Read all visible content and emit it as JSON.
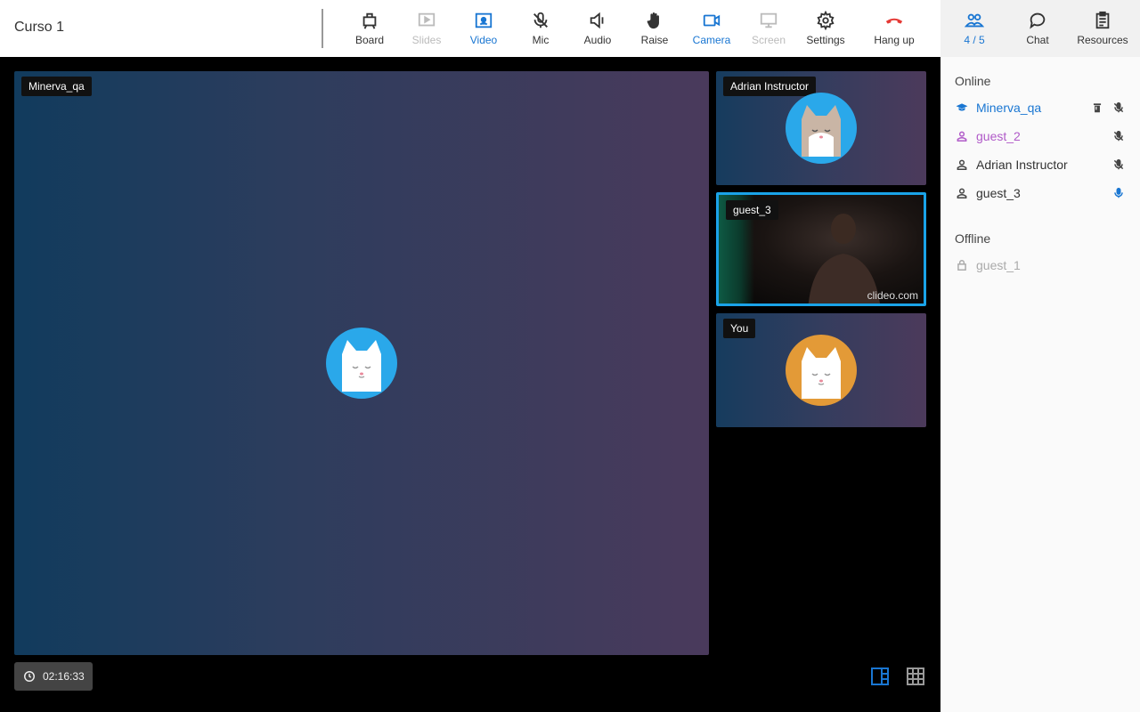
{
  "header": {
    "course_title": "Curso 1"
  },
  "toolbar": {
    "board": "Board",
    "slides": "Slides",
    "video": "Video",
    "mic": "Mic",
    "audio": "Audio",
    "raise": "Raise",
    "camera": "Camera",
    "screen": "Screen",
    "settings": "Settings",
    "hangup": "Hang up"
  },
  "right_tabs": {
    "participants": "4 / 5",
    "chat": "Chat",
    "resources": "Resources"
  },
  "participants": {
    "online_title": "Online",
    "offline_title": "Offline",
    "online": [
      {
        "name": "Minerva_qa",
        "color": "#1976d2",
        "icon": "graduation-cap-icon"
      },
      {
        "name": "guest_2",
        "color": "#b05ac8",
        "icon": "user-icon"
      },
      {
        "name": "Adrian Instructor",
        "color": "#333333",
        "icon": "user-icon"
      },
      {
        "name": "guest_3",
        "color": "#333333",
        "icon": "user-icon"
      }
    ],
    "offline": [
      {
        "name": "guest_1",
        "color": "#aaaaaa",
        "icon": "lock-icon"
      }
    ]
  },
  "main_video": {
    "name": "Minerva_qa"
  },
  "tiles": [
    {
      "name": "Adrian Instructor"
    },
    {
      "name": "guest_3",
      "watermark": "clideo.com"
    },
    {
      "name": "You"
    }
  ],
  "timer": {
    "elapsed": "02:16:33"
  },
  "colors": {
    "accent": "#1976d2",
    "hangup": "#e53935",
    "speaker_border": "#1aa3e8"
  }
}
